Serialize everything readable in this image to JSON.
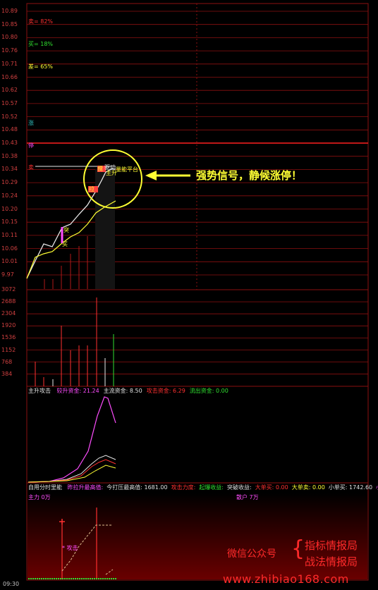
{
  "price_axis": [
    "10.89",
    "10.85",
    "10.80",
    "10.76",
    "10.71",
    "10.66",
    "10.62",
    "10.57",
    "10.52",
    "10.48",
    "10.43",
    "10.38",
    "10.34",
    "10.29",
    "10.24",
    "10.20",
    "10.15",
    "10.11",
    "10.06",
    "10.01",
    "9.97"
  ],
  "volume_axis": [
    "3072",
    "2688",
    "2304",
    "1920",
    "1536",
    "1152",
    "768",
    "384"
  ],
  "stats": {
    "sell_pct": "卖= 82%",
    "buy_pct": "买= 18%",
    "diff_pct": "差= 65%"
  },
  "side_labels": {
    "rise": "涨",
    "stop": "停",
    "sell": "卖"
  },
  "chart_markers": {
    "sudden": "突",
    "buy": "买",
    "stir": "搅",
    "pull": "拉",
    "main_up": "主升",
    "drive": "驱动",
    "volume_platform": "量能平台"
  },
  "annotation": {
    "text": "强势信号，静候涨停！"
  },
  "indicator1": {
    "title": "主升攻击",
    "items": [
      {
        "label": "较升资金:",
        "value": "21.24",
        "color": "#ff4dff"
      },
      {
        "label": "主流资金:",
        "value": "8.50",
        "color": "#e0e0e0"
      },
      {
        "label": "攻击资金:",
        "value": "6.29",
        "color": "#ff3030"
      },
      {
        "label": "流出资金:",
        "value": "0.00",
        "color": "#30e030"
      }
    ]
  },
  "indicator2": {
    "title": "自用分时里能",
    "items": [
      {
        "label": "昨拉升最高值:",
        "value": "",
        "color": "#ff4dff"
      },
      {
        "label": "今打压最高值:",
        "value": "1681.00",
        "color": "#e0e0e0"
      },
      {
        "label": "攻击力度:",
        "value": "",
        "color": "#ff3030"
      },
      {
        "label": "起爆收益:",
        "value": "",
        "color": "#30e030"
      },
      {
        "label": "突破收益:",
        "value": "",
        "color": "#e0e0e0"
      },
      {
        "label": "大单买:",
        "value": "0.00",
        "color": "#ff3030"
      },
      {
        "label": "大单卖:",
        "value": "0.00",
        "color": "#ffff33"
      },
      {
        "label": "小单买:",
        "value": "1742.60",
        "color": "#e0e0e0"
      },
      {
        "label": "小单",
        "value": "",
        "color": "#ff4dff"
      }
    ],
    "main_force": "主力 0万",
    "retail": "散户 7万",
    "attack": "攻击"
  },
  "watermark": {
    "public": "微信公众号",
    "line1": "指标情报局",
    "line2": "战法情报局",
    "url": "www.zhibiao168.com"
  },
  "time_label": "09:30",
  "colors": {
    "grid": "#8b1010",
    "axis_text": "#d04040",
    "yellow": "#ffff33",
    "magenta": "#ff4dff",
    "white": "#e8e8e8"
  }
}
